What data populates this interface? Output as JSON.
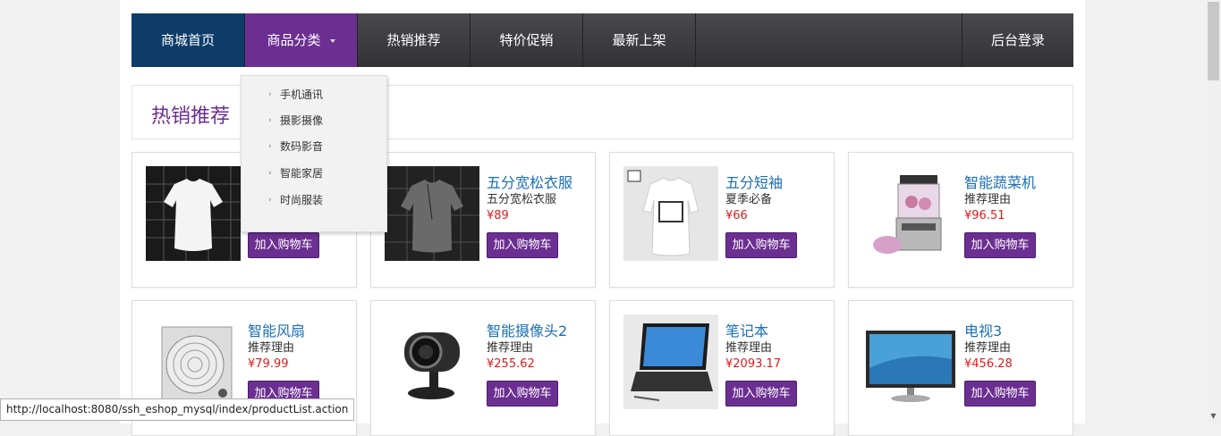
{
  "nav": {
    "home": "商城首页",
    "category": "商品分类",
    "hot": "热销推荐",
    "sale": "特价促销",
    "new": "最新上架",
    "admin": "后台登录"
  },
  "dropdown": {
    "items": [
      "手机通讯",
      "摄影摄像",
      "数码影音",
      "智能家居",
      "时尚服装"
    ]
  },
  "section": {
    "title": "热销推荐"
  },
  "cart_label": "加入购物车",
  "products": [
    {
      "name": "",
      "desc": "",
      "price": ""
    },
    {
      "name": "五分宽松衣服",
      "desc": "五分宽松衣服",
      "price": "¥89"
    },
    {
      "name": "五分短袖",
      "desc": "夏季必备",
      "price": "¥66"
    },
    {
      "name": "智能蔬菜机",
      "desc": "推荐理由",
      "price": "¥96.51"
    },
    {
      "name": "智能风扇",
      "desc": "推荐理由",
      "price": "¥79.99"
    },
    {
      "name": "智能摄像头2",
      "desc": "推荐理由",
      "price": "¥255.62"
    },
    {
      "name": "笔记本",
      "desc": "推荐理由",
      "price": "¥2093.17"
    },
    {
      "name": "电视3",
      "desc": "推荐理由",
      "price": "¥456.28"
    }
  ],
  "status_url": "http://localhost:8080/ssh_eshop_mysql/index/productList.action"
}
